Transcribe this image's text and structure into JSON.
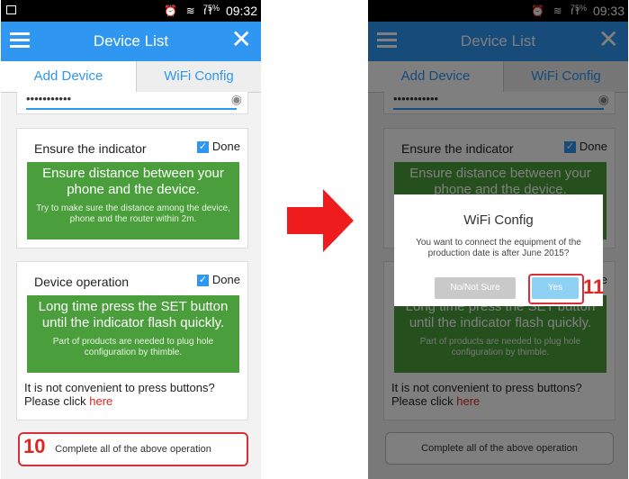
{
  "status": {
    "battery": "75%",
    "left_time": "09:32",
    "right_time": "09:33"
  },
  "appbar": {
    "title": "Device List"
  },
  "tabs": [
    "Add Device",
    "WiFi Config"
  ],
  "password": {
    "masked": "•••••••••••"
  },
  "card1": {
    "title": "Ensure the indicator",
    "done": "Done",
    "big": "Ensure distance between your phone and the device.",
    "small": "Try to make sure the distance among the device, phone and the router within 2m."
  },
  "card2": {
    "title": "Device operation",
    "done": "Done",
    "big": "Long time press the SET button until the indicator flash quickly.",
    "small": "Part of products are needed to plug hole configuration by thimble.",
    "note1": "It is not convenient to press buttons?",
    "note2": "Please click ",
    "link": "here"
  },
  "complete_button": "Complete all of the above operation",
  "dialog": {
    "title": "WiFi Config",
    "message": "You want to connect the equipment of the production date is after June 2015?",
    "no": "No/Not Sure",
    "yes": "Yes"
  },
  "steps": {
    "left": "10",
    "right": "11"
  },
  "colors": {
    "accent": "#2f97f2",
    "green": "#4a9e3b",
    "highlight": "#d8303a",
    "arrow": "#ee1c1c"
  }
}
